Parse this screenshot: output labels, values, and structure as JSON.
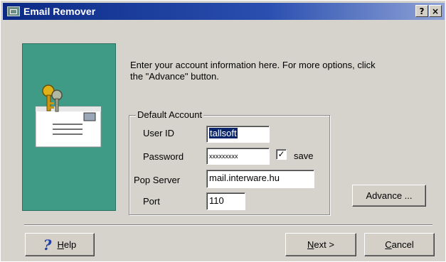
{
  "window": {
    "title": "Email Remover"
  },
  "titlebar": {
    "help_symbol": "?",
    "close_symbol": "×"
  },
  "intro": {
    "line1": "Enter your account information here.   For more options, click",
    "line2": "the \"Advance\" button."
  },
  "group": {
    "title": "Default Account"
  },
  "fields": {
    "user_id_label": "User ID",
    "user_id_value": "tallsoft",
    "password_label": "Password",
    "password_value": "xxxxxxxxx",
    "save_label": "save",
    "save_checked": true,
    "pop_server_label": "Pop Server",
    "pop_server_value": "mail.interware.hu",
    "port_label": "Port",
    "port_value": "110"
  },
  "buttons": {
    "advance": "Advance ...",
    "help_h": "H",
    "help_rest": "elp",
    "next_n": "N",
    "next_rest": "ext >",
    "cancel_c": "C",
    "cancel_rest": "ancel"
  },
  "colors": {
    "title_start": "#0b2a85",
    "image_panel": "#3f9a86",
    "selection": "#0a246a"
  },
  "icons": [
    "app-icon",
    "keys-envelope-icon",
    "help-question-icon",
    "checkmark-icon"
  ]
}
